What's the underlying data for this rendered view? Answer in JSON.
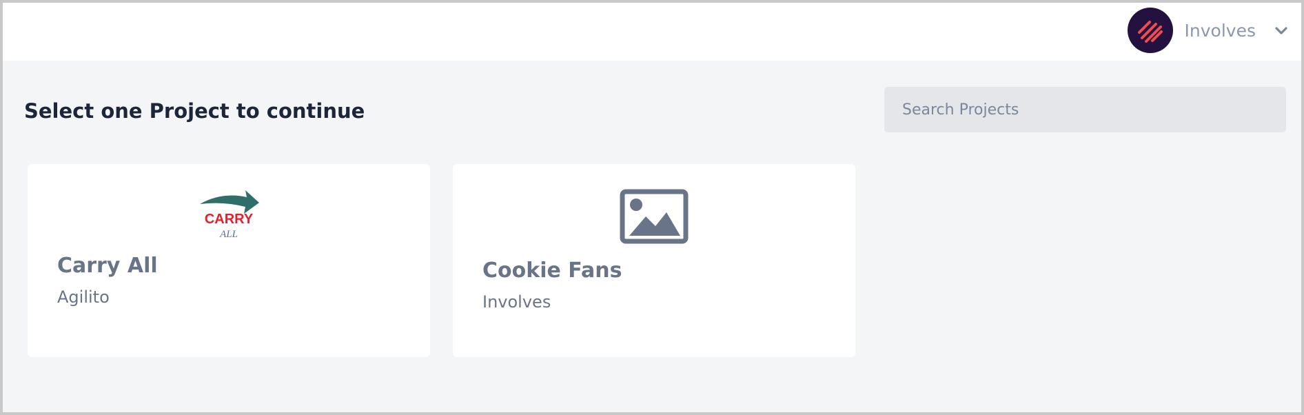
{
  "header": {
    "org_name": "Involves",
    "avatar_icon": "involves-logo-icon",
    "dropdown_icon": "chevron-down-icon"
  },
  "main": {
    "title": "Select one Project to continue",
    "search": {
      "placeholder": "Search Projects",
      "value": ""
    },
    "projects": [
      {
        "name": "Carry All",
        "organization": "Agilito",
        "logo": "carry-all-logo",
        "logo_text": "CARRY",
        "logo_subtext": "ALL"
      },
      {
        "name": "Cookie Fans",
        "organization": "Involves",
        "logo": "image-placeholder-icon"
      }
    ]
  },
  "colors": {
    "page_background": "#f4f5f7",
    "card_background": "#ffffff",
    "avatar_background": "#23113f",
    "avatar_accent": "#ef4c4f",
    "title_text": "#1d2538",
    "muted_text": "#6a7488",
    "search_background": "#e4e6e9"
  }
}
